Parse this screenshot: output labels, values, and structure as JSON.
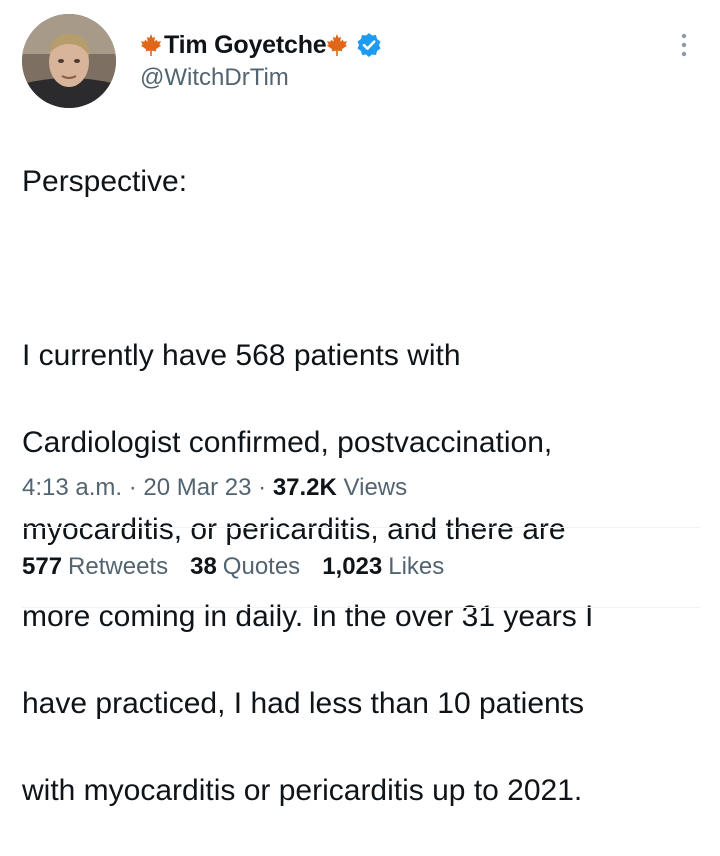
{
  "author": {
    "display_name": "Tim Goyetche",
    "handle": "@WitchDrTim",
    "verified": true,
    "name_decoration_icons": [
      "maple-leaf-icon",
      "maple-leaf-icon"
    ]
  },
  "tweet": {
    "lines": [
      "Perspective:",
      "",
      "I currently have 568 patients with",
      "Cardiologist confirmed, postvaccination,",
      "myocarditis, or pericarditis, and there are",
      "more coming in daily. In the over 31 years I",
      "have practiced, I had less than 10 patients",
      "with myocarditis or pericarditis up to 2021."
    ]
  },
  "meta": {
    "time": "4:13 a.m.",
    "separator": "·",
    "date": "20 Mar 23",
    "views_count": "37.2K",
    "views_label": "Views"
  },
  "stats": {
    "retweets_count": "577",
    "retweets_label": "Retweets",
    "quotes_count": "38",
    "quotes_label": "Quotes",
    "likes_count": "1,023",
    "likes_label": "Likes"
  },
  "colors": {
    "text_primary": "#0f1419",
    "text_secondary": "#536471",
    "verified_blue": "#1d9bf0",
    "maple_leaf": "#e0661a",
    "divider": "#eff3f4"
  }
}
